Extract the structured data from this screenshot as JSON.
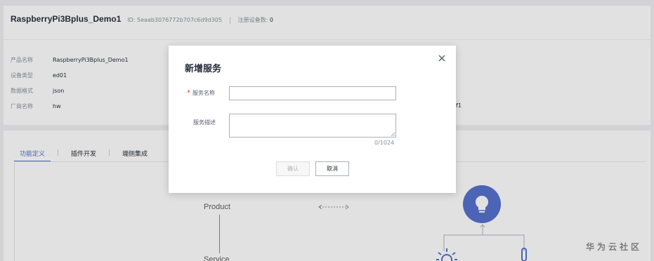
{
  "device": {
    "name": "RaspberryPi3Bplus_Demo1",
    "id_label": "ID: 5eaab3076772b707c6d9d305",
    "registered_label": "注册设备数:",
    "registered_count": "0"
  },
  "info": [
    {
      "key": "产品名称",
      "value": "RaspberryPi3Bplus_Demo1"
    },
    {
      "key": "设备类型",
      "value": "ed01"
    },
    {
      "key": "数据格式",
      "value": "json"
    },
    {
      "key": "厂商名称",
      "value": "hw"
    }
  ],
  "partial_right_value": "f1",
  "tabs": [
    {
      "label": "功能定义",
      "active": true
    },
    {
      "label": "插件开发",
      "active": false
    },
    {
      "label": "端侧集成",
      "active": false
    }
  ],
  "diagram": {
    "product_label": "Product",
    "service_label": "Service",
    "accent_color": "#526ecc",
    "icons": [
      "lightbulb-icon",
      "sun-icon",
      "thermometer-icon"
    ]
  },
  "modal": {
    "title": "新增服务",
    "name_label": "服务名称",
    "name_required_mark": "*",
    "name_value": "",
    "desc_label": "服务描述",
    "desc_value": "",
    "counter": "0/1024",
    "ok_label": "确认",
    "cancel_label": "取消"
  },
  "watermark": "华为云社区"
}
